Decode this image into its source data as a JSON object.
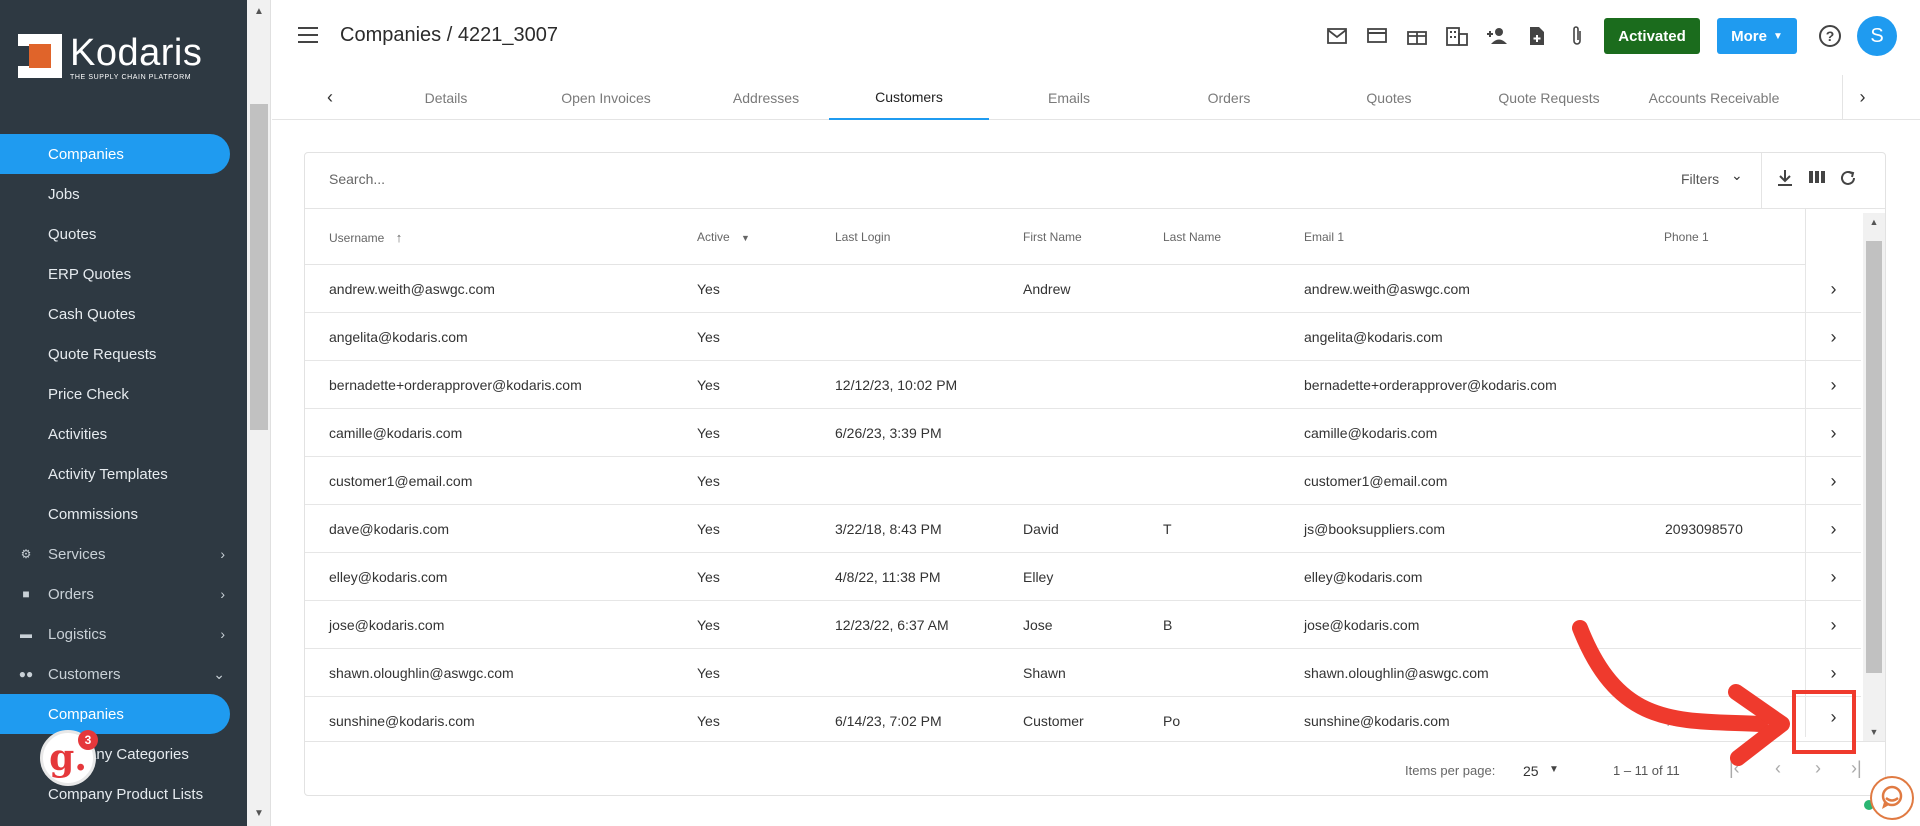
{
  "sidebar": {
    "logo_name": "Kodaris",
    "logo_tagline": "THE SUPPLY CHAIN PLATFORM",
    "items": [
      {
        "label": "Companies",
        "active": true
      },
      {
        "label": "Jobs"
      },
      {
        "label": "Quotes"
      },
      {
        "label": "ERP Quotes"
      },
      {
        "label": "Cash Quotes"
      },
      {
        "label": "Quote Requests"
      },
      {
        "label": "Price Check"
      },
      {
        "label": "Activities"
      },
      {
        "label": "Activity Templates"
      },
      {
        "label": "Commissions"
      }
    ],
    "groups": [
      {
        "label": "Services",
        "icon": "cogs-icon",
        "chevron": "›"
      },
      {
        "label": "Orders",
        "icon": "truck-icon",
        "chevron": "›"
      },
      {
        "label": "Logistics",
        "icon": "car-icon",
        "chevron": "›"
      },
      {
        "label": "Customers",
        "icon": "people-icon",
        "chevron": "⌄"
      }
    ],
    "sub_items": [
      {
        "label": "Companies",
        "active": true
      },
      {
        "label": "Company Categories"
      },
      {
        "label": "Company Product Lists"
      }
    ],
    "notification_badge": {
      "letter": "g.",
      "count": "3"
    }
  },
  "header": {
    "title": "Companies / 4221_3007",
    "activated_label": "Activated",
    "more_label": "More",
    "help_symbol": "?",
    "avatar_initial": "S",
    "toolbar_icons": [
      "mail-icon",
      "card-icon",
      "gift-icon",
      "building-icon",
      "add-person-icon",
      "add-file-icon",
      "paperclip-icon"
    ]
  },
  "tabs": [
    {
      "label": "Details"
    },
    {
      "label": "Open Invoices"
    },
    {
      "label": "Addresses"
    },
    {
      "label": "Customers",
      "active": true
    },
    {
      "label": "Emails"
    },
    {
      "label": "Orders"
    },
    {
      "label": "Quotes"
    },
    {
      "label": "Quote Requests"
    },
    {
      "label": "Accounts Receivable"
    }
  ],
  "table": {
    "search_placeholder": "Search...",
    "filters_label": "Filters",
    "columns": [
      "Username",
      "Active",
      "Last Login",
      "First Name",
      "Last Name",
      "Email 1",
      "Phone 1"
    ],
    "rows": [
      {
        "username": "andrew.weith@aswgc.com",
        "active": "Yes",
        "last_login": "",
        "first_name": "Andrew",
        "last_name": "",
        "email": "andrew.weith@aswgc.com",
        "phone": ""
      },
      {
        "username": "angelita@kodaris.com",
        "active": "Yes",
        "last_login": "",
        "first_name": "",
        "last_name": "",
        "email": "angelita@kodaris.com",
        "phone": ""
      },
      {
        "username": "bernadette+orderapprover@kodaris.com",
        "active": "Yes",
        "last_login": "12/12/23, 10:02 PM",
        "first_name": "",
        "last_name": "",
        "email": "bernadette+orderapprover@kodaris.com",
        "phone": ""
      },
      {
        "username": "camille@kodaris.com",
        "active": "Yes",
        "last_login": "6/26/23, 3:39 PM",
        "first_name": "",
        "last_name": "",
        "email": "camille@kodaris.com",
        "phone": ""
      },
      {
        "username": "customer1@email.com",
        "active": "Yes",
        "last_login": "",
        "first_name": "",
        "last_name": "",
        "email": "customer1@email.com",
        "phone": ""
      },
      {
        "username": "dave@kodaris.com",
        "active": "Yes",
        "last_login": "3/22/18, 8:43 PM",
        "first_name": "David",
        "last_name": "T",
        "email": "js@booksuppliers.com",
        "phone": "2093098570"
      },
      {
        "username": "elley@kodaris.com",
        "active": "Yes",
        "last_login": "4/8/22, 11:38 PM",
        "first_name": "Elley",
        "last_name": "",
        "email": "elley@kodaris.com",
        "phone": ""
      },
      {
        "username": "jose@kodaris.com",
        "active": "Yes",
        "last_login": "12/23/22, 6:37 AM",
        "first_name": "Jose",
        "last_name": "B",
        "email": "jose@kodaris.com",
        "phone": ""
      },
      {
        "username": "shawn.oloughlin@aswgc.com",
        "active": "Yes",
        "last_login": "",
        "first_name": "Shawn",
        "last_name": "",
        "email": "shawn.oloughlin@aswgc.com",
        "phone": ""
      },
      {
        "username": "sunshine@kodaris.com",
        "active": "Yes",
        "last_login": "6/14/23, 7:02 PM",
        "first_name": "Customer",
        "last_name": "Po",
        "email": "sunshine@kodaris.com",
        "phone": "72"
      }
    ]
  },
  "pagination": {
    "items_per_page_label": "Items per page:",
    "page_size": "25",
    "range": "1 – 11 of 11"
  },
  "colors": {
    "accent": "#1f9bf0",
    "sidebar_bg": "#2e3942",
    "activated": "#1b6c1d",
    "annotation": "#ef3a2d"
  }
}
